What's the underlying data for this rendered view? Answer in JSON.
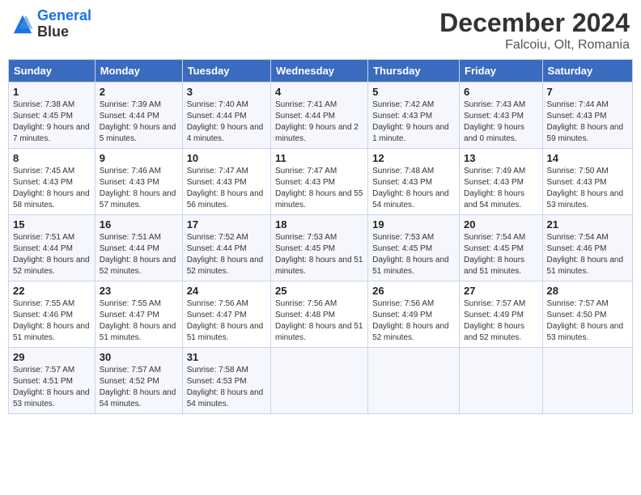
{
  "header": {
    "logo_line1": "General",
    "logo_line2": "Blue",
    "title": "December 2024",
    "subtitle": "Falcoiu, Olt, Romania"
  },
  "days_of_week": [
    "Sunday",
    "Monday",
    "Tuesday",
    "Wednesday",
    "Thursday",
    "Friday",
    "Saturday"
  ],
  "weeks": [
    [
      {
        "day": "1",
        "sunrise": "7:38 AM",
        "sunset": "4:45 PM",
        "daylight": "9 hours and 7 minutes."
      },
      {
        "day": "2",
        "sunrise": "7:39 AM",
        "sunset": "4:44 PM",
        "daylight": "9 hours and 5 minutes."
      },
      {
        "day": "3",
        "sunrise": "7:40 AM",
        "sunset": "4:44 PM",
        "daylight": "9 hours and 4 minutes."
      },
      {
        "day": "4",
        "sunrise": "7:41 AM",
        "sunset": "4:44 PM",
        "daylight": "9 hours and 2 minutes."
      },
      {
        "day": "5",
        "sunrise": "7:42 AM",
        "sunset": "4:43 PM",
        "daylight": "9 hours and 1 minute."
      },
      {
        "day": "6",
        "sunrise": "7:43 AM",
        "sunset": "4:43 PM",
        "daylight": "9 hours and 0 minutes."
      },
      {
        "day": "7",
        "sunrise": "7:44 AM",
        "sunset": "4:43 PM",
        "daylight": "8 hours and 59 minutes."
      }
    ],
    [
      {
        "day": "8",
        "sunrise": "7:45 AM",
        "sunset": "4:43 PM",
        "daylight": "8 hours and 58 minutes."
      },
      {
        "day": "9",
        "sunrise": "7:46 AM",
        "sunset": "4:43 PM",
        "daylight": "8 hours and 57 minutes."
      },
      {
        "day": "10",
        "sunrise": "7:47 AM",
        "sunset": "4:43 PM",
        "daylight": "8 hours and 56 minutes."
      },
      {
        "day": "11",
        "sunrise": "7:47 AM",
        "sunset": "4:43 PM",
        "daylight": "8 hours and 55 minutes."
      },
      {
        "day": "12",
        "sunrise": "7:48 AM",
        "sunset": "4:43 PM",
        "daylight": "8 hours and 54 minutes."
      },
      {
        "day": "13",
        "sunrise": "7:49 AM",
        "sunset": "4:43 PM",
        "daylight": "8 hours and 54 minutes."
      },
      {
        "day": "14",
        "sunrise": "7:50 AM",
        "sunset": "4:43 PM",
        "daylight": "8 hours and 53 minutes."
      }
    ],
    [
      {
        "day": "15",
        "sunrise": "7:51 AM",
        "sunset": "4:44 PM",
        "daylight": "8 hours and 52 minutes."
      },
      {
        "day": "16",
        "sunrise": "7:51 AM",
        "sunset": "4:44 PM",
        "daylight": "8 hours and 52 minutes."
      },
      {
        "day": "17",
        "sunrise": "7:52 AM",
        "sunset": "4:44 PM",
        "daylight": "8 hours and 52 minutes."
      },
      {
        "day": "18",
        "sunrise": "7:53 AM",
        "sunset": "4:45 PM",
        "daylight": "8 hours and 51 minutes."
      },
      {
        "day": "19",
        "sunrise": "7:53 AM",
        "sunset": "4:45 PM",
        "daylight": "8 hours and 51 minutes."
      },
      {
        "day": "20",
        "sunrise": "7:54 AM",
        "sunset": "4:45 PM",
        "daylight": "8 hours and 51 minutes."
      },
      {
        "day": "21",
        "sunrise": "7:54 AM",
        "sunset": "4:46 PM",
        "daylight": "8 hours and 51 minutes."
      }
    ],
    [
      {
        "day": "22",
        "sunrise": "7:55 AM",
        "sunset": "4:46 PM",
        "daylight": "8 hours and 51 minutes."
      },
      {
        "day": "23",
        "sunrise": "7:55 AM",
        "sunset": "4:47 PM",
        "daylight": "8 hours and 51 minutes."
      },
      {
        "day": "24",
        "sunrise": "7:56 AM",
        "sunset": "4:47 PM",
        "daylight": "8 hours and 51 minutes."
      },
      {
        "day": "25",
        "sunrise": "7:56 AM",
        "sunset": "4:48 PM",
        "daylight": "8 hours and 51 minutes."
      },
      {
        "day": "26",
        "sunrise": "7:56 AM",
        "sunset": "4:49 PM",
        "daylight": "8 hours and 52 minutes."
      },
      {
        "day": "27",
        "sunrise": "7:57 AM",
        "sunset": "4:49 PM",
        "daylight": "8 hours and 52 minutes."
      },
      {
        "day": "28",
        "sunrise": "7:57 AM",
        "sunset": "4:50 PM",
        "daylight": "8 hours and 53 minutes."
      }
    ],
    [
      {
        "day": "29",
        "sunrise": "7:57 AM",
        "sunset": "4:51 PM",
        "daylight": "8 hours and 53 minutes."
      },
      {
        "day": "30",
        "sunrise": "7:57 AM",
        "sunset": "4:52 PM",
        "daylight": "8 hours and 54 minutes."
      },
      {
        "day": "31",
        "sunrise": "7:58 AM",
        "sunset": "4:53 PM",
        "daylight": "8 hours and 54 minutes."
      },
      null,
      null,
      null,
      null
    ]
  ]
}
